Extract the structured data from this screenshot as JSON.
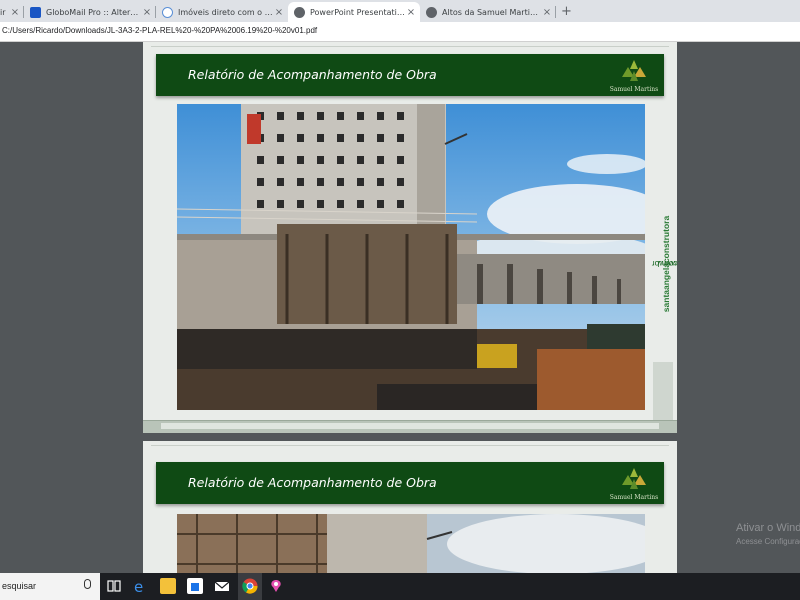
{
  "browser": {
    "tabs": [
      {
        "label": "ir",
        "icon": "doc-icon",
        "active": false
      },
      {
        "label": "GloboMail Pro :: Alteração de se",
        "icon": "globomail-icon",
        "active": false
      },
      {
        "label": "Imóveis direto com o proprietário",
        "icon": "link-icon",
        "active": false
      },
      {
        "label": "PowerPoint Presentation",
        "icon": "globe-icon",
        "active": true
      },
      {
        "label": "Altos da Samuel Martins - Santa",
        "icon": "globe-icon",
        "active": false
      }
    ],
    "close_glyph": "×",
    "new_tab_glyph": "+",
    "address": "C:/Users/Ricardo/Downloads/JL-3A3-2-PLA-REL%20-%20PA%2006.19%20-%20v01.pdf"
  },
  "pdf": {
    "pages": [
      {
        "banner_title": "Relatório de Acompanhamento de Obra",
        "logo_text": "Samuel Martins"
      },
      {
        "banner_title": "Relatório de Acompanhamento de Obra",
        "logo_text": "Samuel Martins"
      }
    ],
    "side_url_prefix": "www.",
    "side_url_bold": "santaangelaconstrutora",
    "side_url_suffix": ".com.br"
  },
  "watermark": {
    "line1": "Ativar o Windows",
    "line2": "Acesse Configurações"
  },
  "taskbar": {
    "search_text": "esquisar",
    "icons": [
      "mic-icon",
      "task-view-icon",
      "edge-icon",
      "file-explorer-icon",
      "store-icon",
      "mail-icon",
      "chrome-icon",
      "paint-icon"
    ]
  },
  "colors": {
    "banner_green": "#0f4a14",
    "viewer_bg": "#525659",
    "page_bg": "#e9ece9"
  }
}
